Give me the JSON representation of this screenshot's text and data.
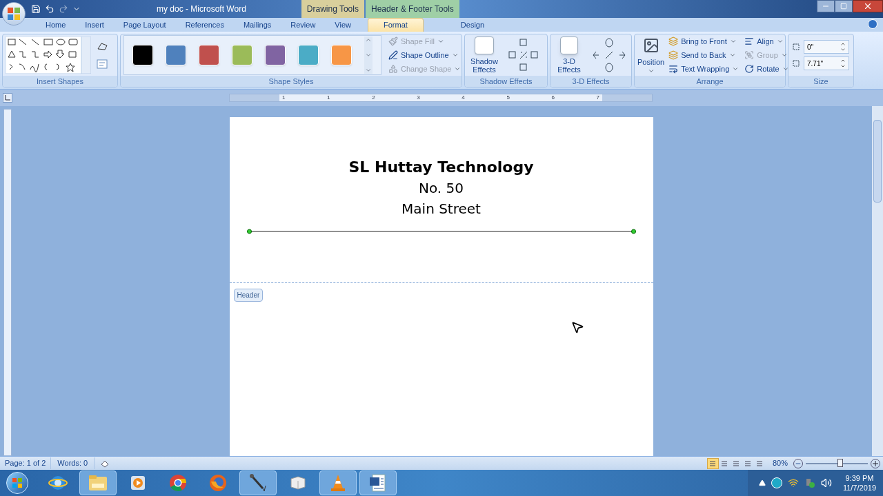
{
  "window": {
    "title": "my doc - Microsoft Word",
    "context_tabs": [
      {
        "label": "Drawing Tools",
        "color": "#d9cf9c"
      },
      {
        "label": "Header & Footer Tools",
        "color": "#9fcfa6"
      }
    ]
  },
  "ribbon_tabs": [
    {
      "label": "Home",
      "selected": false
    },
    {
      "label": "Insert",
      "selected": false
    },
    {
      "label": "Page Layout",
      "selected": false
    },
    {
      "label": "References",
      "selected": false
    },
    {
      "label": "Mailings",
      "selected": false
    },
    {
      "label": "Review",
      "selected": false
    },
    {
      "label": "View",
      "selected": false
    },
    {
      "label": "Format",
      "selected": true
    },
    {
      "label": "Design",
      "selected": false
    }
  ],
  "insert_shapes": {
    "label": "Insert Shapes"
  },
  "shape_styles": {
    "label": "Shape Styles",
    "swatches": [
      {
        "color": "#000000"
      },
      {
        "color": "#4f81bd"
      },
      {
        "color": "#c0504d"
      },
      {
        "color": "#9bbb59"
      },
      {
        "color": "#8064a2"
      },
      {
        "color": "#4bacc6"
      },
      {
        "color": "#f79646"
      }
    ],
    "commands": [
      {
        "label": "Shape Fill",
        "disabled": true
      },
      {
        "label": "Shape Outline",
        "disabled": false
      },
      {
        "label": "Change Shape",
        "disabled": true
      }
    ]
  },
  "shadow_effects": {
    "label": "Shadow Effects",
    "button": "Shadow Effects"
  },
  "three_d_effects": {
    "label": "3-D Effects",
    "button": "3-D Effects"
  },
  "arrange": {
    "label": "Arrange",
    "position": "Position",
    "commands": [
      {
        "label": "Bring to Front",
        "disabled": false
      },
      {
        "label": "Send to Back",
        "disabled": false
      },
      {
        "label": "Text Wrapping",
        "disabled": false
      },
      {
        "label": "Align",
        "disabled": false
      },
      {
        "label": "Group",
        "disabled": true
      },
      {
        "label": "Rotate",
        "disabled": false
      }
    ]
  },
  "size": {
    "label": "Size",
    "height": "0\"",
    "width": "7.71\""
  },
  "ruler": {
    "marks": [
      "1",
      "1",
      "2",
      "3",
      "4",
      "5",
      "6",
      "7"
    ]
  },
  "document": {
    "header_lines": [
      {
        "text": "SL Huttay Technology",
        "bold": true
      },
      {
        "text": "No. 50",
        "bold": false
      },
      {
        "text": "Main Street",
        "bold": false
      }
    ],
    "header_tag": "Header"
  },
  "status_bar": {
    "page": "Page: 1 of 2",
    "words": "Words: 0",
    "zoom": "80%",
    "level": 0.55,
    "views": [
      {
        "selected": true
      },
      {
        "selected": false
      },
      {
        "selected": false
      },
      {
        "selected": false
      },
      {
        "selected": false
      }
    ]
  },
  "taskbar": {
    "apps": [
      {
        "kind": "browser-e",
        "active": false
      },
      {
        "kind": "folder",
        "active": true
      },
      {
        "kind": "player",
        "active": false
      },
      {
        "kind": "chrome",
        "active": false
      },
      {
        "kind": "firefox",
        "active": false
      },
      {
        "kind": "microphone",
        "active": true
      },
      {
        "kind": "cube",
        "active": false
      },
      {
        "kind": "cone",
        "active": true
      },
      {
        "kind": "word",
        "active": true
      }
    ],
    "time": "9:39 PM",
    "date": "11/7/2019"
  }
}
